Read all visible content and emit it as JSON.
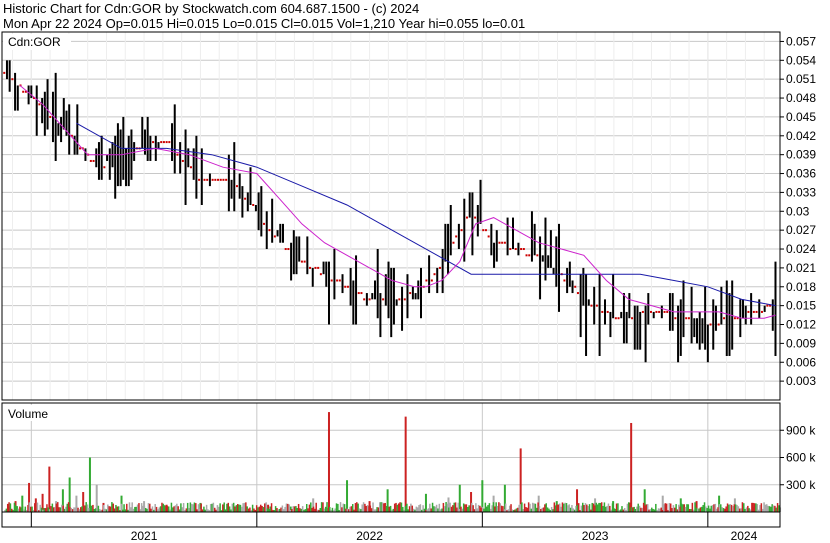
{
  "header": {
    "line1": "Historic Chart for Cdn:GOR by Stockwatch.com 604.687.1500 - (c) 2024",
    "line2": "Mon Apr 22 2024  Op=0.015  Hi=0.015  Lo=0.015  Cl=0.015  Vol=1,210  Year hi=0.055  lo=0.01"
  },
  "colors": {
    "price_bar": "#000000",
    "tick_dot": "#cc0000",
    "ma_long": "#1a1aa8",
    "ma_short": "#cc22cc",
    "vol_up": "#33aa33",
    "vol_down": "#cc2222",
    "vol_flat": "#aaaaaa",
    "grid": "#c8c8c8",
    "frame": "#000000"
  },
  "chart_data": [
    {
      "type": "line",
      "title": "Cdn:GOR",
      "x_labels": [
        "2021",
        "2022",
        "2023",
        "2024"
      ],
      "y_ticks": [
        "0.057",
        "0.054",
        "0.051",
        "0.048",
        "0.045",
        "0.042",
        "0.039",
        "0.036",
        "0.033",
        "0.03",
        "0.027",
        "0.024",
        "0.021",
        "0.018",
        "0.015",
        "0.012",
        "0.009",
        "0.006",
        "0.003"
      ],
      "ylim": [
        0.0,
        0.0585
      ],
      "grid": true,
      "series": [
        {
          "name": "",
          "style": "price",
          "x": [
            2020.88,
            2021.0,
            2021.1,
            2021.2,
            2021.3,
            2021.45,
            2021.6,
            2021.75,
            2021.9,
            2022.05,
            2022.2,
            2022.35,
            2022.5,
            2022.65,
            2022.8,
            2022.95,
            2023.05,
            2023.15,
            2023.3,
            2023.45,
            2023.6,
            2023.75,
            2023.9,
            2024.0,
            2024.1,
            2024.2,
            2024.3
          ],
          "values": [
            0.052,
            0.048,
            0.045,
            0.041,
            0.037,
            0.04,
            0.041,
            0.035,
            0.035,
            0.027,
            0.022,
            0.019,
            0.016,
            0.016,
            0.02,
            0.03,
            0.025,
            0.024,
            0.022,
            0.016,
            0.013,
            0.014,
            0.013,
            0.012,
            0.013,
            0.014,
            0.015
          ]
        },
        {
          "name": "",
          "style": "ma_long",
          "x": [
            2021.2,
            2021.4,
            2021.6,
            2021.8,
            2022.0,
            2022.2,
            2022.4,
            2022.6,
            2022.8,
            2022.95,
            2023.1,
            2023.3,
            2023.5,
            2023.7,
            2023.85,
            2024.0,
            2024.15,
            2024.3
          ],
          "values": [
            0.044,
            0.04,
            0.04,
            0.039,
            0.037,
            0.034,
            0.031,
            0.027,
            0.023,
            0.02,
            0.02,
            0.02,
            0.02,
            0.02,
            0.019,
            0.018,
            0.016,
            0.015
          ]
        },
        {
          "name": "",
          "style": "ma_short",
          "x": [
            2020.95,
            2021.05,
            2021.15,
            2021.25,
            2021.4,
            2021.55,
            2021.7,
            2021.85,
            2022.0,
            2022.1,
            2022.2,
            2022.3,
            2022.4,
            2022.5,
            2022.6,
            2022.7,
            2022.75,
            2022.82,
            2022.9,
            2022.97,
            2023.05,
            2023.15,
            2023.25,
            2023.35,
            2023.45,
            2023.55,
            2023.65,
            2023.75,
            2023.85,
            2023.95,
            2024.05,
            2024.15,
            2024.25,
            2024.3
          ],
          "values": [
            0.05,
            0.047,
            0.043,
            0.039,
            0.039,
            0.04,
            0.039,
            0.037,
            0.036,
            0.032,
            0.028,
            0.025,
            0.023,
            0.021,
            0.019,
            0.018,
            0.018,
            0.019,
            0.022,
            0.028,
            0.029,
            0.027,
            0.025,
            0.024,
            0.023,
            0.019,
            0.016,
            0.015,
            0.014,
            0.014,
            0.014,
            0.013,
            0.013,
            0.0135
          ]
        }
      ]
    },
    {
      "type": "bar",
      "title": "Volume",
      "y_ticks": [
        "900 k",
        "600 k",
        "300 k"
      ],
      "ylim": [
        0,
        1200000
      ],
      "volume": [
        {
          "x": 2020.9,
          "v": 60000,
          "c": "down"
        },
        {
          "x": 2020.93,
          "v": 120000,
          "c": "down"
        },
        {
          "x": 2020.96,
          "v": 180000,
          "c": "up"
        },
        {
          "x": 2020.99,
          "v": 320000,
          "c": "down"
        },
        {
          "x": 2021.02,
          "v": 150000,
          "c": "down"
        },
        {
          "x": 2021.05,
          "v": 200000,
          "c": "down"
        },
        {
          "x": 2021.08,
          "v": 500000,
          "c": "down"
        },
        {
          "x": 2021.11,
          "v": 120000,
          "c": "flat"
        },
        {
          "x": 2021.14,
          "v": 250000,
          "c": "up"
        },
        {
          "x": 2021.17,
          "v": 380000,
          "c": "up"
        },
        {
          "x": 2021.2,
          "v": 180000,
          "c": "flat"
        },
        {
          "x": 2021.23,
          "v": 220000,
          "c": "down"
        },
        {
          "x": 2021.26,
          "v": 600000,
          "c": "up"
        },
        {
          "x": 2021.29,
          "v": 300000,
          "c": "flat"
        },
        {
          "x": 2021.32,
          "v": 100000,
          "c": "down"
        },
        {
          "x": 2021.4,
          "v": 180000,
          "c": "up"
        },
        {
          "x": 2021.5,
          "v": 120000,
          "c": "flat"
        },
        {
          "x": 2021.6,
          "v": 80000,
          "c": "down"
        },
        {
          "x": 2021.75,
          "v": 100000,
          "c": "up"
        },
        {
          "x": 2021.9,
          "v": 60000,
          "c": "flat"
        },
        {
          "x": 2022.05,
          "v": 80000,
          "c": "down"
        },
        {
          "x": 2022.15,
          "v": 60000,
          "c": "up"
        },
        {
          "x": 2022.25,
          "v": 150000,
          "c": "flat"
        },
        {
          "x": 2022.32,
          "v": 1100000,
          "c": "down"
        },
        {
          "x": 2022.4,
          "v": 350000,
          "c": "up"
        },
        {
          "x": 2022.5,
          "v": 120000,
          "c": "down"
        },
        {
          "x": 2022.58,
          "v": 250000,
          "c": "up"
        },
        {
          "x": 2022.66,
          "v": 1050000,
          "c": "down"
        },
        {
          "x": 2022.75,
          "v": 200000,
          "c": "up"
        },
        {
          "x": 2022.85,
          "v": 160000,
          "c": "flat"
        },
        {
          "x": 2022.9,
          "v": 300000,
          "c": "up"
        },
        {
          "x": 2022.95,
          "v": 220000,
          "c": "down"
        },
        {
          "x": 2023.0,
          "v": 350000,
          "c": "up"
        },
        {
          "x": 2023.05,
          "v": 180000,
          "c": "flat"
        },
        {
          "x": 2023.1,
          "v": 300000,
          "c": "up"
        },
        {
          "x": 2023.17,
          "v": 700000,
          "c": "down"
        },
        {
          "x": 2023.25,
          "v": 180000,
          "c": "flat"
        },
        {
          "x": 2023.33,
          "v": 120000,
          "c": "up"
        },
        {
          "x": 2023.42,
          "v": 250000,
          "c": "down"
        },
        {
          "x": 2023.5,
          "v": 150000,
          "c": "flat"
        },
        {
          "x": 2023.58,
          "v": 120000,
          "c": "up"
        },
        {
          "x": 2023.66,
          "v": 980000,
          "c": "down"
        },
        {
          "x": 2023.72,
          "v": 250000,
          "c": "up"
        },
        {
          "x": 2023.8,
          "v": 180000,
          "c": "flat"
        },
        {
          "x": 2023.88,
          "v": 150000,
          "c": "up"
        },
        {
          "x": 2023.95,
          "v": 120000,
          "c": "down"
        },
        {
          "x": 2024.05,
          "v": 180000,
          "c": "up"
        },
        {
          "x": 2024.12,
          "v": 150000,
          "c": "flat"
        },
        {
          "x": 2024.2,
          "v": 100000,
          "c": "down"
        },
        {
          "x": 2024.28,
          "v": 60000,
          "c": "flat"
        }
      ]
    }
  ]
}
